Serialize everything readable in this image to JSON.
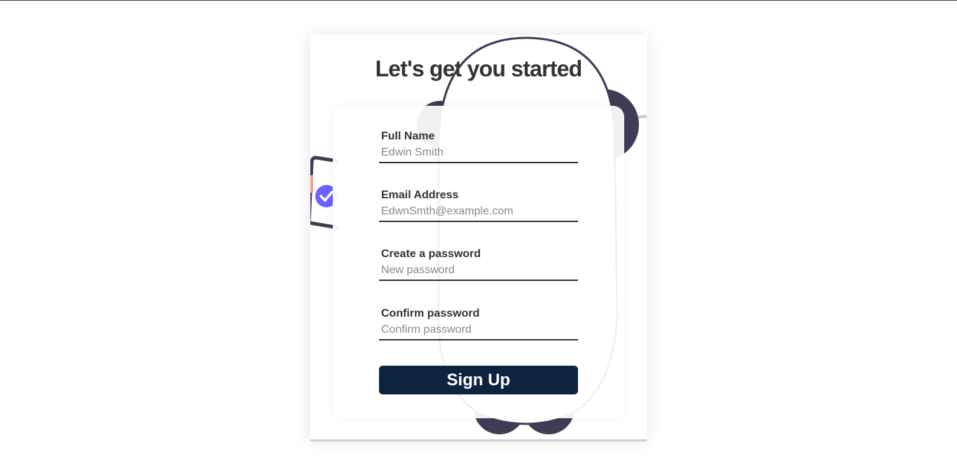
{
  "page": {
    "title": "Let's get you started"
  },
  "form": {
    "fields": [
      {
        "label": "Full Name",
        "placeholder": "Edwin Smith",
        "type": "text"
      },
      {
        "label": "Email Address",
        "placeholder": "EdwnSmth@example.com",
        "type": "email"
      },
      {
        "label": "Create a password",
        "placeholder": "New password",
        "type": "password"
      },
      {
        "label": "Confirm password",
        "placeholder": "Confirm password",
        "type": "password"
      }
    ],
    "submit_label": "Sign Up"
  },
  "illustration": {
    "name": "user-verification-illustration",
    "icons": [
      "checkmark-icon",
      "phone-icon",
      "avatar-icon"
    ]
  },
  "colors": {
    "button": "#0c2440",
    "illustration_dark": "#3f3d56",
    "accent": "#6c63ff",
    "text": "#333333"
  }
}
